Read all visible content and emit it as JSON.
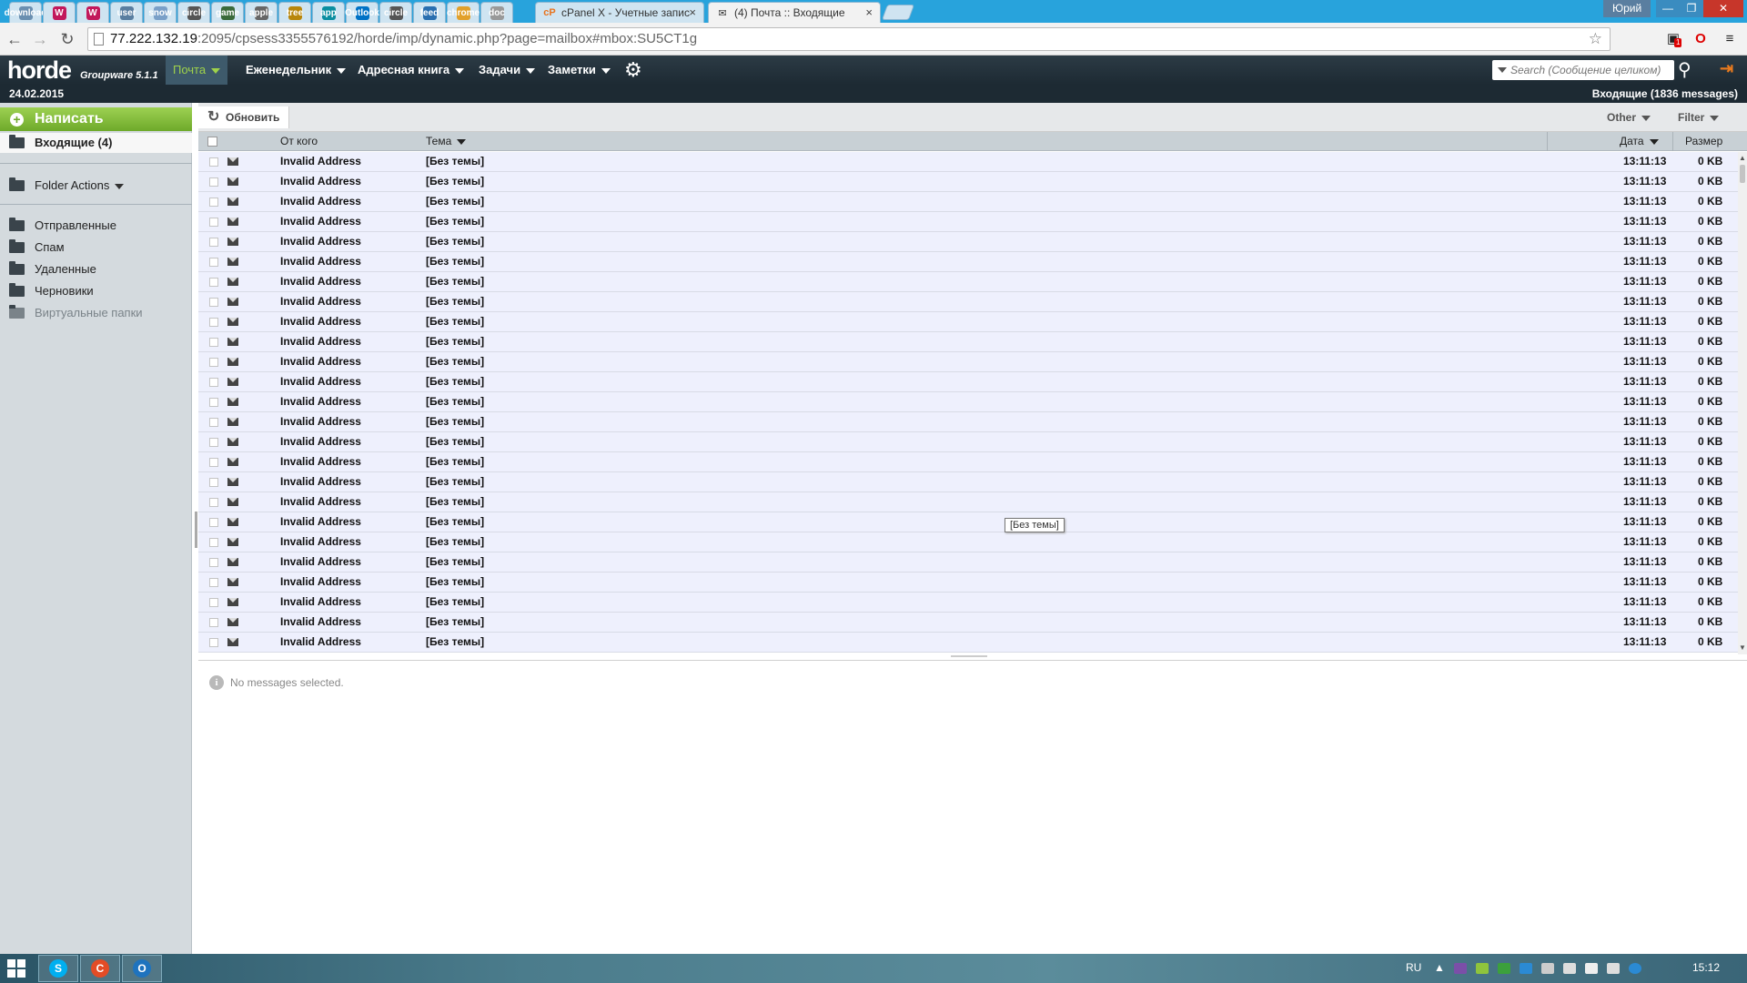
{
  "browser": {
    "pinned_tabs": [
      "download",
      "W",
      "W",
      "user",
      "snow",
      "circle",
      "game",
      "apple",
      "tree",
      "app",
      "Outlook",
      "circle",
      "feed",
      "chrome",
      "doc"
    ],
    "tabs": [
      {
        "label": "cPanel X - Учетные запис",
        "icon": "cP"
      },
      {
        "label": "(4) Почта :: Входящие",
        "icon": "✉"
      }
    ],
    "profile_name": "Юрий",
    "url_host": "77.222.132.19",
    "url_path": ":2095/cpsess3355576192/horde/imp/dynamic.php?page=mailbox#mbox:SU5CT1g",
    "extension_badge": "1"
  },
  "horde": {
    "logo": "horde",
    "logo_sub": "Groupware 5.1.1",
    "menu": [
      "Почта",
      "Еженедельник",
      "Адресная книга",
      "Задачи",
      "Заметки"
    ],
    "search_placeholder": "Search (Сообщение целиком)",
    "date": "24.02.2015",
    "mailbox_summary": "Входящие (1836 messages)"
  },
  "sidebar": {
    "compose": "Написать",
    "inbox": "Входящие (4)",
    "folder_actions": "Folder Actions",
    "folders": [
      "Отправленные",
      "Спам",
      "Удаленные",
      "Черновики"
    ],
    "virtual": "Виртуальные папки"
  },
  "list": {
    "refresh": "Обновить",
    "other": "Other",
    "filter": "Filter",
    "headers": {
      "from": "От кого",
      "subject": "Тема",
      "date": "Дата",
      "size": "Размер"
    },
    "rows": [
      {
        "from": "Invalid Address",
        "subject": "[Без темы]",
        "time": "13:11:13",
        "size": "0 KB"
      },
      {
        "from": "Invalid Address",
        "subject": "[Без темы]",
        "time": "13:11:13",
        "size": "0 KB"
      },
      {
        "from": "Invalid Address",
        "subject": "[Без темы]",
        "time": "13:11:13",
        "size": "0 KB"
      },
      {
        "from": "Invalid Address",
        "subject": "[Без темы]",
        "time": "13:11:13",
        "size": "0 KB"
      },
      {
        "from": "Invalid Address",
        "subject": "[Без темы]",
        "time": "13:11:13",
        "size": "0 KB"
      },
      {
        "from": "Invalid Address",
        "subject": "[Без темы]",
        "time": "13:11:13",
        "size": "0 KB"
      },
      {
        "from": "Invalid Address",
        "subject": "[Без темы]",
        "time": "13:11:13",
        "size": "0 KB"
      },
      {
        "from": "Invalid Address",
        "subject": "[Без темы]",
        "time": "13:11:13",
        "size": "0 KB"
      },
      {
        "from": "Invalid Address",
        "subject": "[Без темы]",
        "time": "13:11:13",
        "size": "0 KB"
      },
      {
        "from": "Invalid Address",
        "subject": "[Без темы]",
        "time": "13:11:13",
        "size": "0 KB"
      },
      {
        "from": "Invalid Address",
        "subject": "[Без темы]",
        "time": "13:11:13",
        "size": "0 KB"
      },
      {
        "from": "Invalid Address",
        "subject": "[Без темы]",
        "time": "13:11:13",
        "size": "0 KB"
      },
      {
        "from": "Invalid Address",
        "subject": "[Без темы]",
        "time": "13:11:13",
        "size": "0 KB"
      },
      {
        "from": "Invalid Address",
        "subject": "[Без темы]",
        "time": "13:11:13",
        "size": "0 KB"
      },
      {
        "from": "Invalid Address",
        "subject": "[Без темы]",
        "time": "13:11:13",
        "size": "0 KB"
      },
      {
        "from": "Invalid Address",
        "subject": "[Без темы]",
        "time": "13:11:13",
        "size": "0 KB"
      },
      {
        "from": "Invalid Address",
        "subject": "[Без темы]",
        "time": "13:11:13",
        "size": "0 KB"
      },
      {
        "from": "Invalid Address",
        "subject": "[Без темы]",
        "time": "13:11:13",
        "size": "0 KB"
      },
      {
        "from": "Invalid Address",
        "subject": "[Без темы]",
        "time": "13:11:13",
        "size": "0 KB"
      },
      {
        "from": "Invalid Address",
        "subject": "[Без темы]",
        "time": "13:11:13",
        "size": "0 KB"
      },
      {
        "from": "Invalid Address",
        "subject": "[Без темы]",
        "time": "13:11:13",
        "size": "0 KB"
      },
      {
        "from": "Invalid Address",
        "subject": "[Без темы]",
        "time": "13:11:13",
        "size": "0 KB"
      },
      {
        "from": "Invalid Address",
        "subject": "[Без темы]",
        "time": "13:11:13",
        "size": "0 KB"
      },
      {
        "from": "Invalid Address",
        "subject": "[Без темы]",
        "time": "13:11:13",
        "size": "0 KB"
      },
      {
        "from": "Invalid Address",
        "subject": "[Без темы]",
        "time": "13:11:13",
        "size": "0 KB"
      }
    ],
    "tooltip": "[Без темы]"
  },
  "preview": {
    "empty_text": "No messages selected."
  },
  "taskbar": {
    "lang": "RU",
    "clock": "15:12",
    "apps": [
      "S",
      "C",
      "O"
    ]
  },
  "colors": {
    "accent_green": "#7ab536",
    "horde_dark": "#1d2a33",
    "row_bg": "#eef0fd",
    "chrome_blue": "#28a3dc"
  }
}
